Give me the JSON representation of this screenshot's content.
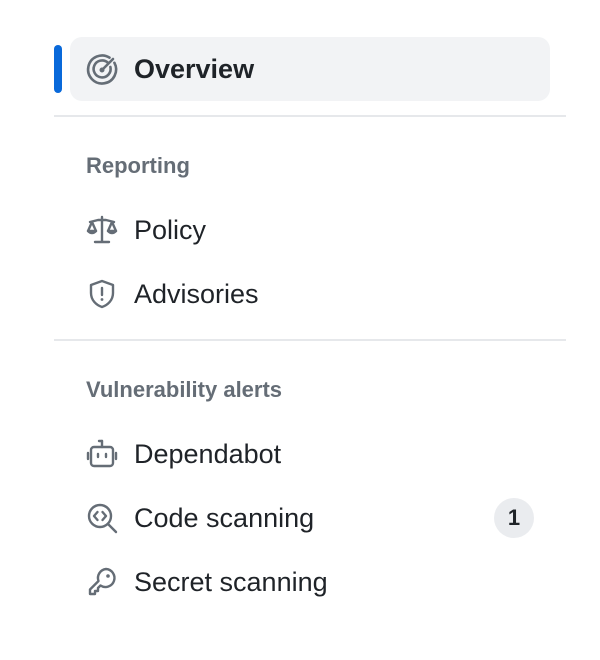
{
  "nav": {
    "overview": {
      "label": "Overview",
      "icon": "meter-icon",
      "active": true
    },
    "sections": [
      {
        "heading": "Reporting",
        "items": [
          {
            "label": "Policy",
            "icon": "law-icon"
          },
          {
            "label": "Advisories",
            "icon": "shield-alert-icon"
          }
        ]
      },
      {
        "heading": "Vulnerability alerts",
        "items": [
          {
            "label": "Dependabot",
            "icon": "robot-icon"
          },
          {
            "label": "Code scanning",
            "icon": "codescan-icon",
            "badge": "1"
          },
          {
            "label": "Secret scanning",
            "icon": "key-icon"
          }
        ]
      }
    ]
  },
  "colors": {
    "accent": "#0969da",
    "text": "#1f2328",
    "muted": "#656d76",
    "active_bg": "#f2f3f5",
    "divider": "#e6e8eb",
    "badge_bg": "#eaecef"
  }
}
